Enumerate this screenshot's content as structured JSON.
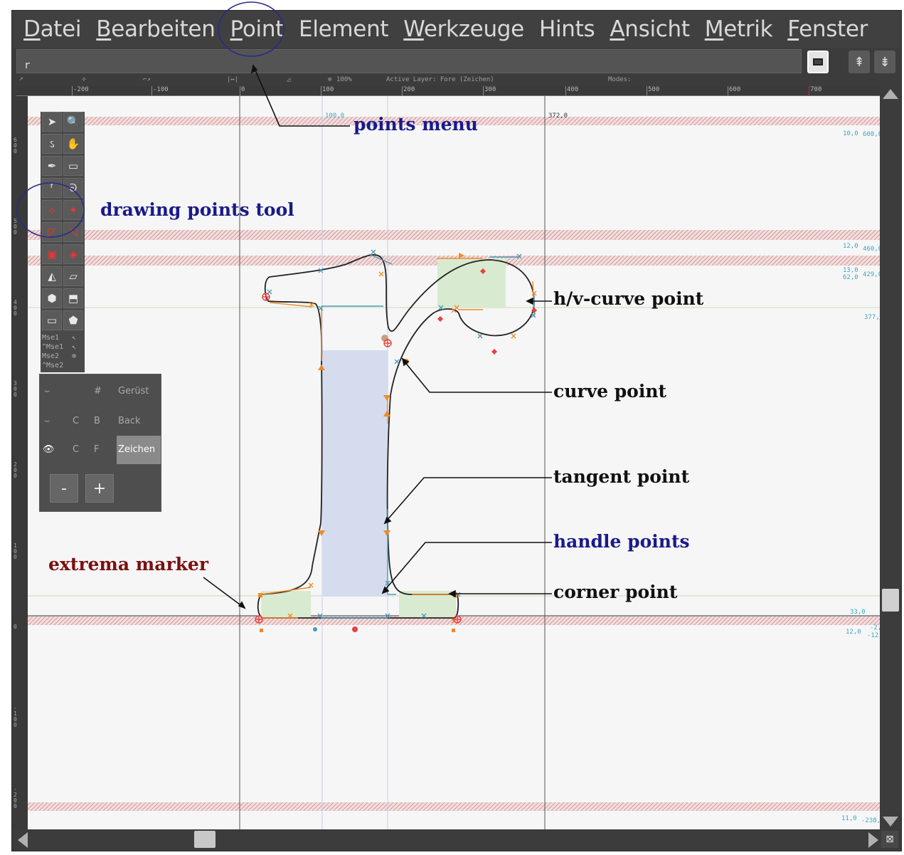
{
  "menubar": {
    "items": [
      {
        "mn": "D",
        "rest": "atei"
      },
      {
        "mn": "B",
        "rest": "earbeiten"
      },
      {
        "mn": "P",
        "rest": "oint"
      },
      {
        "mn": "",
        "rest": "Element"
      },
      {
        "mn": "W",
        "rest": "erkzeuge"
      },
      {
        "mn": "",
        "rest": "Hints"
      },
      {
        "mn": "A",
        "rest": "nsicht"
      },
      {
        "mn": "M",
        "rest": "etrik"
      },
      {
        "mn": "F",
        "rest": "enster"
      }
    ]
  },
  "textbar": {
    "value": "r"
  },
  "infobar": {
    "zoom": "100%",
    "active_layer": "Active Layer: Fore (Zeichen)",
    "modes": "Modes:"
  },
  "ruler": {
    "labels": [
      "-200",
      "-100",
      "0",
      "100",
      "200",
      "300",
      "400",
      "500",
      "600",
      "700"
    ]
  },
  "vruler": {
    "labels": [
      "600",
      "500",
      "400",
      "300",
      "200",
      "100",
      "0",
      "-100",
      "-200"
    ]
  },
  "canvas": {
    "coord_labels": [
      "100,0",
      "79,0",
      "372,0"
    ],
    "guide_labels": [
      "10,0",
      "600,0",
      "12,0",
      "460,0",
      "13,0",
      "62,0",
      "429,0",
      "377,0",
      "33,0",
      "12,0",
      "-2,0",
      "-12,0",
      "11,0",
      "-238,0"
    ]
  },
  "tools": {
    "mse": [
      "Mse1",
      "^Mse1",
      "Mse2",
      "^Mse2"
    ]
  },
  "layers": {
    "rows": [
      {
        "c": "",
        "b": "#",
        "name": "Gerüst"
      },
      {
        "c": "C",
        "b": "B",
        "name": "Back"
      },
      {
        "c": "C",
        "b": "F",
        "name": "Zeichen"
      }
    ],
    "minus": "-",
    "plus": "+"
  },
  "annotations": {
    "points_menu": "points menu",
    "drawing_points_tool": "drawing points tool",
    "hv_curve_point": "h/v-curve point",
    "curve_point": "curve point",
    "tangent_point": "tangent point",
    "handle_points": "handle points",
    "extrema_marker": "extrema marker",
    "corner_point": "corner point"
  },
  "colors": {
    "canvas_bg": "#f6f6f6",
    "outline": "#222222",
    "handle_orange": "#f08a28",
    "handle_blue": "#4a9ab8",
    "point_red": "#e84040",
    "fill_green": "#d8ead0",
    "fill_blue": "#d4dcee",
    "guide_pink": "#e0a8a8",
    "annotation_blue": "#1a1a8a",
    "annotation_red": "#7a1010"
  }
}
